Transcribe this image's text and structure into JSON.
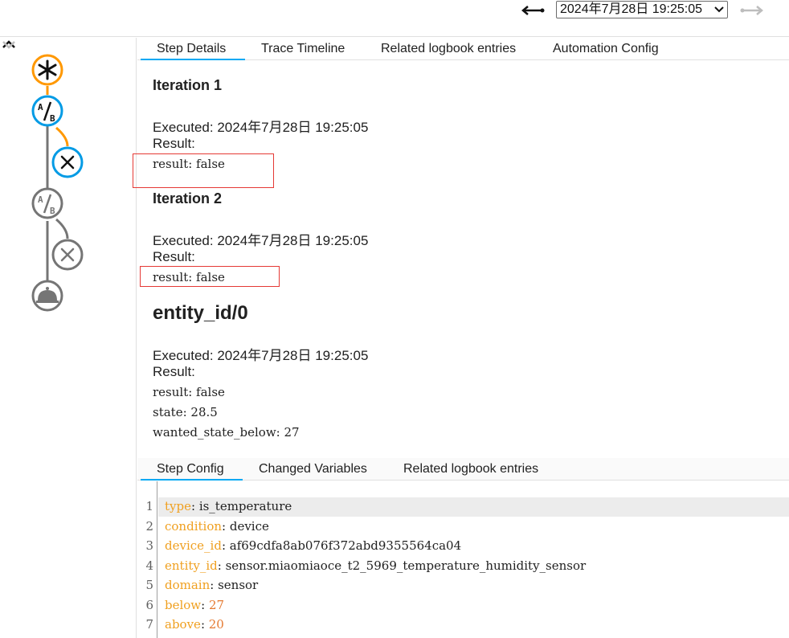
{
  "topbar": {
    "selected_trace": "2024年7月28日 19:25:05"
  },
  "tabs": [
    {
      "label": "Step Details"
    },
    {
      "label": "Trace Timeline"
    },
    {
      "label": "Related logbook entries"
    },
    {
      "label": "Automation Config"
    }
  ],
  "details": {
    "iteration1": {
      "title": "Iteration 1",
      "executed": "Executed: 2024年7月28日 19:25:05",
      "result_label": "Result:",
      "result_value": "result: false"
    },
    "iteration2": {
      "title": "Iteration 2",
      "executed": "Executed: 2024年7月28日 19:25:05",
      "result_label": "Result:",
      "result_value": "result: false"
    },
    "entity": {
      "title": "entity_id/0",
      "executed": "Executed: 2024年7月28日 19:25:05",
      "result_label": "Result:",
      "lines": [
        "result: false",
        "state: 28.5",
        "wanted_state_below: 27"
      ]
    }
  },
  "bottom_tabs": [
    {
      "label": "Step Config"
    },
    {
      "label": "Changed Variables"
    },
    {
      "label": "Related logbook entries"
    }
  ],
  "config_lines": [
    {
      "n": "1",
      "key": "type",
      "value": "is_temperature",
      "numeric": false
    },
    {
      "n": "2",
      "key": "condition",
      "value": "device",
      "numeric": false
    },
    {
      "n": "3",
      "key": "device_id",
      "value": "af69cdfa8ab076f372abd9355564ca04",
      "numeric": false
    },
    {
      "n": "4",
      "key": "entity_id",
      "value": "sensor.miaomiaoce_t2_5969_temperature_humidity_sensor",
      "numeric": false
    },
    {
      "n": "5",
      "key": "domain",
      "value": "sensor",
      "numeric": false
    },
    {
      "n": "6",
      "key": "below",
      "value": "27",
      "numeric": true
    },
    {
      "n": "7",
      "key": "above",
      "value": "20",
      "numeric": true
    }
  ],
  "colors": {
    "accent": "#03a9f4",
    "trigger": "#ff9800",
    "condition_active": "#039be5",
    "inactive": "#757575",
    "highlight_box": "#e53935"
  },
  "icons": [
    "arrow-left-icon",
    "arrow-right-icon",
    "chevron-up-icon",
    "chevron-down-icon",
    "trigger-asterisk-icon",
    "condition-ab-icon",
    "close-x-icon",
    "bell-icon"
  ]
}
